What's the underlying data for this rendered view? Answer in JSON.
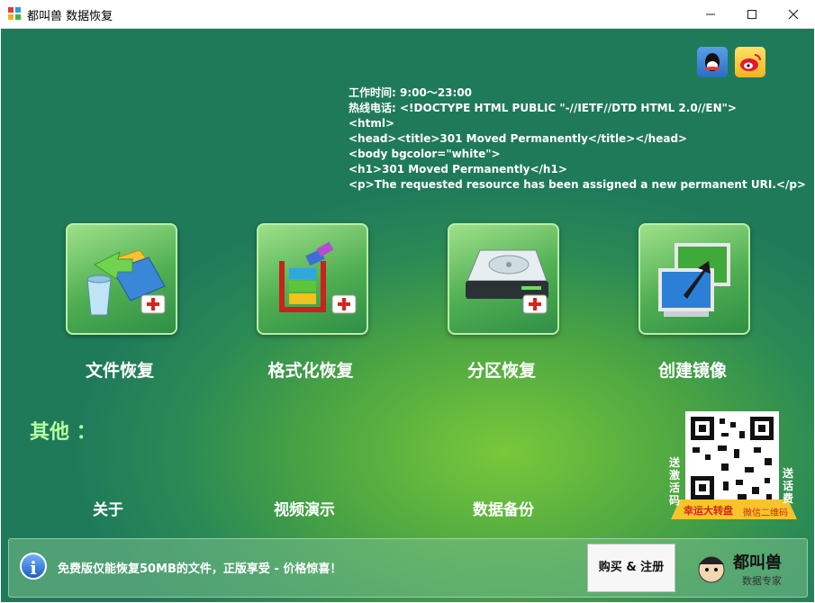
{
  "window": {
    "title": "都叫兽 数据恢复"
  },
  "info": {
    "hours": "工作时间: 9:00～23:00",
    "hotline_label": "热线电话:",
    "lines": [
      "<!DOCTYPE HTML PUBLIC \"-//IETF//DTD HTML 2.0//EN\">",
      "<html>",
      "<head><title>301 Moved Permanently</title></head>",
      "<body bgcolor=\"white\">",
      "<h1>301 Moved Permanently</h1>",
      "<p>The requested resource has been assigned a new permanent URI.</p>"
    ]
  },
  "tools": [
    {
      "label": "文件恢复",
      "icon": "file-recovery-icon"
    },
    {
      "label": "格式化恢复",
      "icon": "format-recovery-icon"
    },
    {
      "label": "分区恢复",
      "icon": "partition-recovery-icon"
    },
    {
      "label": "创建镜像",
      "icon": "create-image-icon"
    }
  ],
  "others": {
    "heading": "其他 ：",
    "links": [
      "关于",
      "视频演示",
      "数据备份"
    ]
  },
  "promo": {
    "left_vertical": "送激活码",
    "right_vertical": "送话费",
    "ribbon_left": "幸运大转盘",
    "ribbon_right": "微信二维码"
  },
  "bottom": {
    "notice": "免费版仅能恢复50MB的文件，正版享受 - 价格惊喜！",
    "buy_label": "购买 & 注册",
    "brand_text": "都叫兽",
    "brand_sub": "数据专家"
  },
  "colors": {
    "accent": "#2a8a55",
    "highlight": "#78c83a"
  }
}
